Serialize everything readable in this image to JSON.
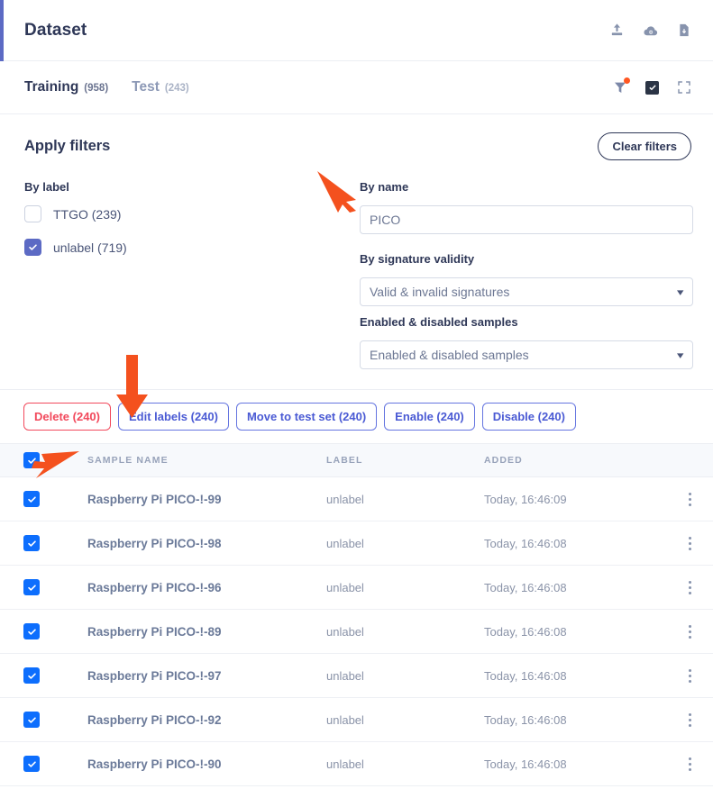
{
  "header": {
    "title": "Dataset",
    "icons": [
      {
        "name": "upload-icon"
      },
      {
        "name": "cloud-upload-icon"
      },
      {
        "name": "file-download-icon"
      }
    ]
  },
  "tabbar": {
    "tabs": [
      {
        "label": "Training",
        "count": "(958)",
        "active": true
      },
      {
        "label": "Test",
        "count": "(243)",
        "active": false
      }
    ],
    "icons": [
      {
        "name": "filter-icon",
        "badge": true
      },
      {
        "name": "select-all-checkbox-icon"
      },
      {
        "name": "fullscreen-icon"
      }
    ]
  },
  "filters": {
    "title": "Apply filters",
    "clear_label": "Clear filters",
    "by_label": {
      "label": "By label",
      "options": [
        {
          "text": "TTGO (239)",
          "checked": false
        },
        {
          "text": "unlabel (719)",
          "checked": true
        }
      ]
    },
    "by_name": {
      "label": "By name",
      "value": "PICO"
    },
    "by_signature": {
      "label": "By signature validity",
      "value": "Valid & invalid signatures"
    },
    "by_enabled": {
      "label": "Enabled & disabled samples",
      "value": "Enabled & disabled samples"
    }
  },
  "actions": [
    {
      "label": "Delete (240)",
      "style": "danger"
    },
    {
      "label": "Edit labels (240)",
      "style": "primary"
    },
    {
      "label": "Move to test set (240)",
      "style": "primary"
    },
    {
      "label": "Enable (240)",
      "style": "primary"
    },
    {
      "label": "Disable (240)",
      "style": "primary"
    }
  ],
  "table": {
    "columns": [
      "SAMPLE NAME",
      "LABEL",
      "ADDED"
    ],
    "select_all_checked": true,
    "rows": [
      {
        "checked": true,
        "name": "Raspberry Pi PICO-!-99",
        "label": "unlabel",
        "added": "Today, 16:46:09"
      },
      {
        "checked": true,
        "name": "Raspberry Pi PICO-!-98",
        "label": "unlabel",
        "added": "Today, 16:46:08"
      },
      {
        "checked": true,
        "name": "Raspberry Pi PICO-!-96",
        "label": "unlabel",
        "added": "Today, 16:46:08"
      },
      {
        "checked": true,
        "name": "Raspberry Pi PICO-!-89",
        "label": "unlabel",
        "added": "Today, 16:46:08"
      },
      {
        "checked": true,
        "name": "Raspberry Pi PICO-!-97",
        "label": "unlabel",
        "added": "Today, 16:46:08"
      },
      {
        "checked": true,
        "name": "Raspberry Pi PICO-!-92",
        "label": "unlabel",
        "added": "Today, 16:46:08"
      },
      {
        "checked": true,
        "name": "Raspberry Pi PICO-!-90",
        "label": "unlabel",
        "added": "Today, 16:46:08"
      }
    ]
  },
  "colors": {
    "accent": "#5c6ac4",
    "primary_text": "#2e3757",
    "danger": "#f2495c",
    "checkbox_blue": "#0d6efd",
    "annotation_arrow": "#f4511e",
    "badge_dot": "#ff5722"
  }
}
